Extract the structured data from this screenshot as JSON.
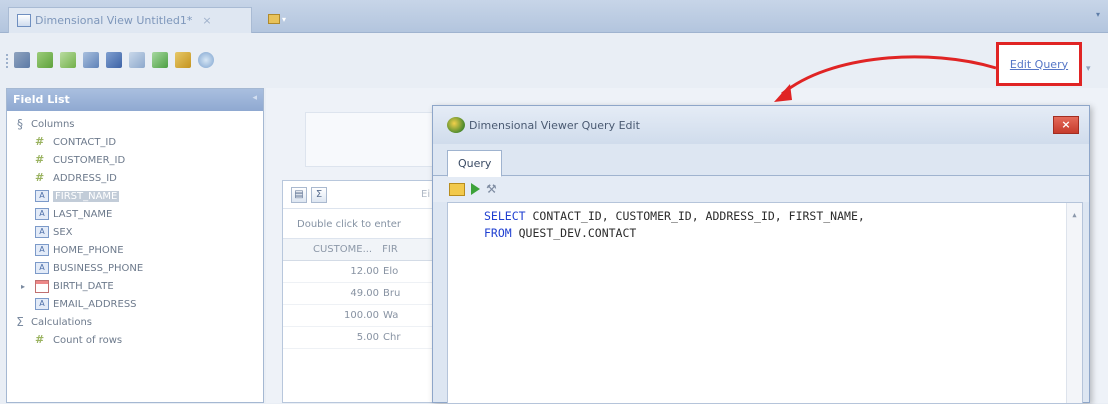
{
  "tabstrip": {
    "doc_tab_label": "Dimensional View Untitled1*",
    "doc_tab_close": "×"
  },
  "toolbar": {
    "edit_query_label": "Edit Query",
    "icons": [
      "add-field-icon",
      "pivot-icon",
      "sort-icon",
      "grid-icon",
      "save-icon",
      "filter-icon",
      "chart-icon",
      "bars-icon",
      "refresh-icon"
    ]
  },
  "field_list": {
    "title": "Field List",
    "columns_label": "Columns",
    "columns": [
      {
        "type": "number",
        "label": "CONTACT_ID"
      },
      {
        "type": "number",
        "label": "CUSTOMER_ID"
      },
      {
        "type": "number",
        "label": "ADDRESS_ID"
      },
      {
        "type": "string",
        "label": "FIRST_NAME",
        "selected": true
      },
      {
        "type": "string",
        "label": "LAST_NAME"
      },
      {
        "type": "string",
        "label": "SEX"
      },
      {
        "type": "string",
        "label": "HOME_PHONE"
      },
      {
        "type": "string",
        "label": "BUSINESS_PHONE"
      },
      {
        "type": "date",
        "label": "BIRTH_DATE"
      },
      {
        "type": "string",
        "label": "EMAIL_ADDRESS"
      }
    ],
    "calculations_label": "Calculations",
    "calculations": [
      {
        "type": "number",
        "label": "Count of rows"
      }
    ]
  },
  "grid": {
    "double_click_text": "Double click to enter",
    "col_header_1": "CUSTOME...",
    "col_header_2": "FIR",
    "rows": [
      {
        "value": "12.00",
        "name": "Elo"
      },
      {
        "value": "49.00",
        "name": "Bru"
      },
      {
        "value": "100.00",
        "name": "Wa"
      },
      {
        "value": "5.00",
        "name": "Chr"
      }
    ]
  },
  "dialog": {
    "title": "Dimensional Viewer Query Edit",
    "close_label": "×",
    "tab_label": "Query",
    "sql_line1_kw": "SELECT",
    "sql_line1_rest": " CONTACT_ID, CUSTOMER_ID, ADDRESS_ID, FIRST_NAME,",
    "sql_line2_kw": "FROM",
    "sql_line2_rest": " QUEST_DEV.CONTACT"
  },
  "colors": {
    "highlight_red": "#e02424",
    "sql_keyword": "#1f3fd1"
  }
}
